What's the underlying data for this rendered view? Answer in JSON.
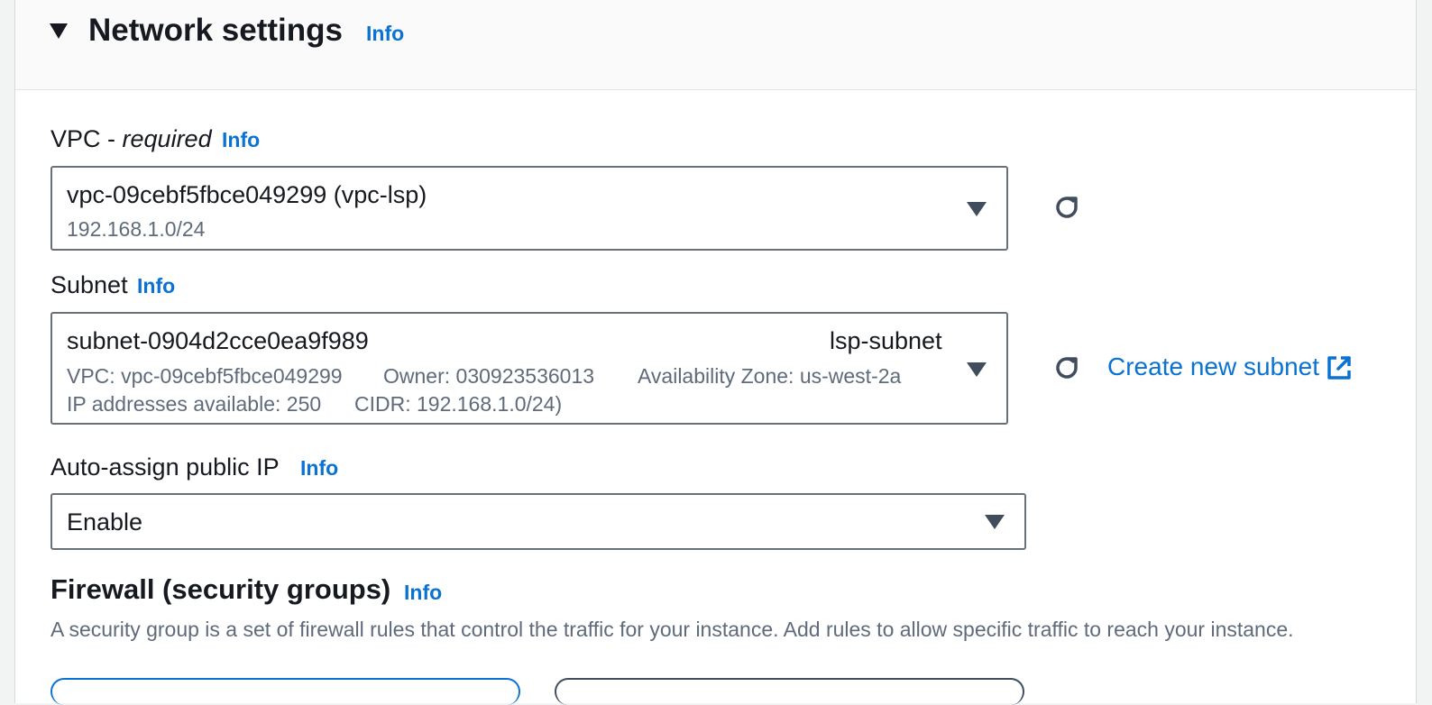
{
  "section": {
    "title": "Network settings",
    "info": "Info"
  },
  "vpc": {
    "label_prefix": "VPC -",
    "label_required": "required",
    "info": "Info",
    "selected_value": "vpc-09cebf5fbce049299 (vpc-lsp)",
    "selected_cidr": "192.168.1.0/24"
  },
  "subnet": {
    "label": "Subnet",
    "info": "Info",
    "selected_id": "subnet-0904d2cce0ea9f989",
    "selected_name": "lsp-subnet",
    "vpc_detail": "VPC: vpc-09cebf5fbce049299",
    "owner_detail": "Owner: 030923536013",
    "az_detail": "Availability Zone: us-west-2a",
    "ip_detail": "IP addresses available: 250",
    "cidr_detail": "CIDR: 192.168.1.0/24)",
    "create_link": "Create new subnet"
  },
  "public_ip": {
    "label": "Auto-assign public IP",
    "info": "Info",
    "selected_value": "Enable"
  },
  "firewall": {
    "title": "Firewall (security groups)",
    "info": "Info",
    "description": "A security group is a set of firewall rules that control the traffic for your instance. Add rules to allow specific traffic to reach your instance."
  },
  "icons": {
    "caret": "caret-down-icon",
    "refresh": "refresh-icon",
    "external": "external-link-icon"
  },
  "colors": {
    "link": "#0972d3",
    "text": "#16191f",
    "secondary_text": "#5f6b7a",
    "border": "#687078"
  }
}
